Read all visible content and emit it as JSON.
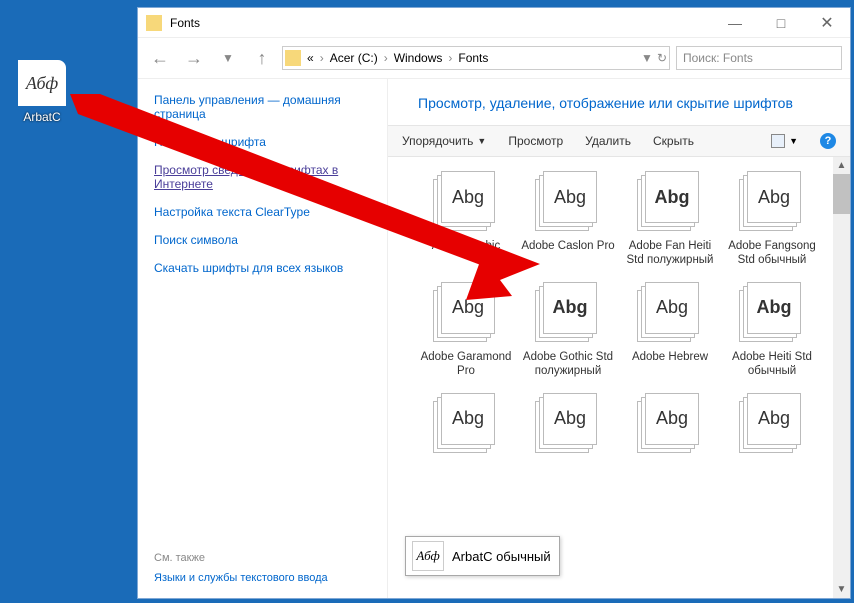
{
  "desktop": {
    "icon_text": "Абф",
    "icon_label": "ArbatC"
  },
  "window": {
    "title": "Fonts",
    "breadcrumb": {
      "parts": [
        "«",
        "Acer (C:)",
        "Windows",
        "Fonts"
      ]
    },
    "search_placeholder": "Поиск: Fonts"
  },
  "sidebar": {
    "control_home": "Панель управления — домашняя страница",
    "links": [
      "Параметры шрифта",
      "Просмотр сведений о шрифтах в Интернете",
      "Настройка текста ClearType",
      "Поиск символа",
      "Скачать шрифты для всех языков"
    ],
    "see_also_label": "См. также",
    "see_also_link": "Языки и службы текстового ввода"
  },
  "main": {
    "heading": "Просмотр, удаление, отображение или скрытие шрифтов",
    "toolbar": {
      "organize": "Упорядочить",
      "view": "Просмотр",
      "delete": "Удалить",
      "hide": "Скрыть"
    },
    "fonts": [
      {
        "name": "Adobe Arabic",
        "sample": "Abg",
        "bold": false
      },
      {
        "name": "Adobe Caslon Pro",
        "sample": "Abg",
        "bold": false
      },
      {
        "name": "Adobe Fan Heiti Std полужирный",
        "sample": "Abg",
        "bold": true
      },
      {
        "name": "Adobe Fangsong Std обычный",
        "sample": "Abg",
        "bold": false
      },
      {
        "name": "Adobe Garamond Pro",
        "sample": "Abg",
        "bold": false
      },
      {
        "name": "Adobe Gothic Std полужирный",
        "sample": "Abg",
        "bold": true
      },
      {
        "name": "Adobe Hebrew",
        "sample": "Abg",
        "bold": false
      },
      {
        "name": "Adobe Heiti Std обычный",
        "sample": "Abg",
        "bold": true
      },
      {
        "name": "",
        "sample": "Abg",
        "bold": false
      },
      {
        "name": "",
        "sample": "Abg",
        "bold": false
      },
      {
        "name": "",
        "sample": "Abg",
        "bold": false
      },
      {
        "name": "",
        "sample": "Abg",
        "bold": false
      }
    ]
  },
  "drag": {
    "preview_text": "Абф",
    "label": "ArbatC обычный"
  }
}
